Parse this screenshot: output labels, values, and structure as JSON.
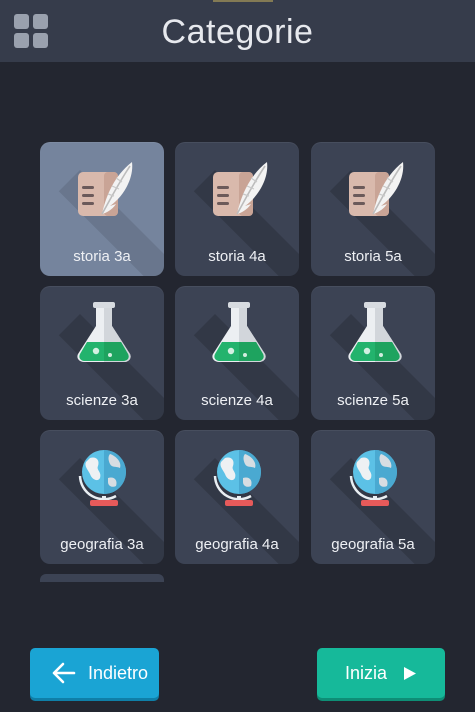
{
  "header": {
    "title": "Categorie",
    "menu_icon": "grid-icon"
  },
  "categories": [
    {
      "label": "storia 3a",
      "icon": "quill-scroll-icon",
      "selected": true
    },
    {
      "label": "storia 4a",
      "icon": "quill-scroll-icon",
      "selected": false
    },
    {
      "label": "storia 5a",
      "icon": "quill-scroll-icon",
      "selected": false
    },
    {
      "label": "scienze 3a",
      "icon": "flask-icon",
      "selected": false
    },
    {
      "label": "scienze 4a",
      "icon": "flask-icon",
      "selected": false
    },
    {
      "label": "scienze 5a",
      "icon": "flask-icon",
      "selected": false
    },
    {
      "label": "geografia 3a",
      "icon": "globe-icon",
      "selected": false
    },
    {
      "label": "geografia 4a",
      "icon": "globe-icon",
      "selected": false
    },
    {
      "label": "geografia 5a",
      "icon": "globe-icon",
      "selected": false
    }
  ],
  "footer": {
    "back_label": "Indietro",
    "back_icon": "arrow-left-icon",
    "start_label": "Inizia",
    "start_icon": "play-icon"
  },
  "colors": {
    "background": "#232630",
    "header": "#363c4b",
    "tile": "#3c4354",
    "tile_selected": "#75849d",
    "back_button": "#1aa4d4",
    "start_button": "#16b99a"
  }
}
